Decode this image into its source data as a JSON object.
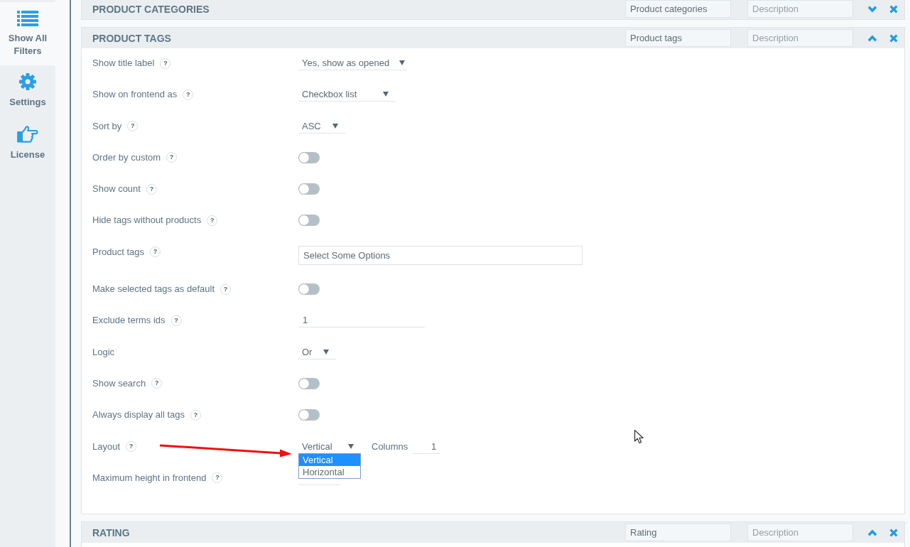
{
  "sidebar": {
    "items": [
      {
        "label": "Show All Filters",
        "selected": true
      },
      {
        "label": "Settings",
        "selected": false
      },
      {
        "label": "License",
        "selected": false
      }
    ]
  },
  "panels": [
    {
      "title": "PRODUCT CATEGORIES",
      "name_value": "Product categories",
      "description_placeholder": "Description",
      "expanded": false
    },
    {
      "title": "PRODUCT TAGS",
      "name_value": "Product tags",
      "description_placeholder": "Description",
      "expanded": true,
      "rows": [
        {
          "label": "Show title label",
          "help": "?",
          "kind": "select",
          "value": "Yes, show as opened"
        },
        {
          "label": "Show on frontend as",
          "help": "?",
          "kind": "select",
          "value": "Checkbox list"
        },
        {
          "label": "Sort by",
          "help": "?",
          "kind": "select",
          "value": "ASC"
        },
        {
          "label": "Order by custom",
          "help": "?",
          "kind": "toggle",
          "on": false
        },
        {
          "label": "Show count",
          "help": "?",
          "kind": "toggle",
          "on": false
        },
        {
          "label": "Hide tags without products",
          "help": "?",
          "kind": "toggle",
          "on": false
        },
        {
          "label": "Product tags",
          "help": "?",
          "kind": "multiselect",
          "placeholder": "Select Some Options"
        },
        {
          "label": "Make selected tags as default",
          "help": "?",
          "kind": "toggle",
          "on": false
        },
        {
          "label": "Exclude terms ids",
          "help": "?",
          "kind": "input",
          "value": "1"
        },
        {
          "label": "Logic",
          "kind": "select",
          "value": "Or"
        },
        {
          "label": "Show search",
          "help": "?",
          "kind": "toggle",
          "on": false
        },
        {
          "label": "Always display all tags",
          "help": "?",
          "kind": "toggle",
          "on": false
        },
        {
          "label": "Layout",
          "help": "?",
          "kind": "layout",
          "value": "Vertical",
          "expanded": true,
          "options": [
            {
              "label": "Vertical",
              "selected": true
            },
            {
              "label": "Horizontal",
              "selected": false
            }
          ],
          "columns_label": "Columns",
          "columns_value": "1"
        },
        {
          "label": "Maximum height in frontend",
          "help": "?",
          "kind": "number"
        }
      ]
    },
    {
      "title": "RATING",
      "name_value": "Rating",
      "description_placeholder": "Description",
      "expanded": true
    }
  ]
}
